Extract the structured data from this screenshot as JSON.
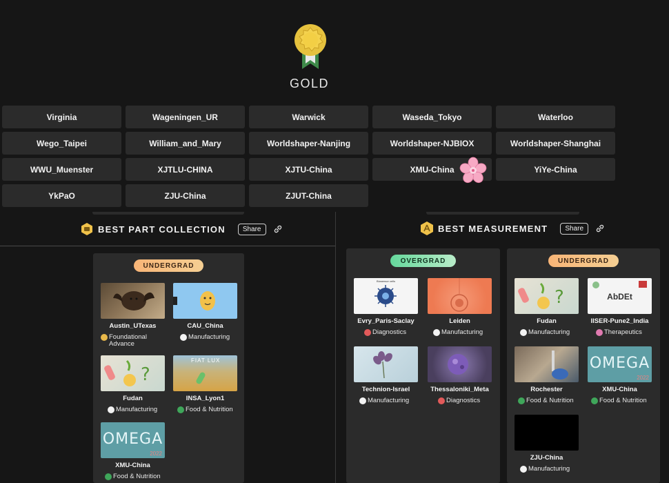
{
  "award": {
    "title": "GOLD",
    "icon": "gold-medal-icon"
  },
  "teams": [
    "Virginia",
    "Wageningen_UR",
    "Warwick",
    "Waseda_Tokyo",
    "Waterloo",
    "Wego_Taipei",
    "William_and_Mary",
    "Worldshaper-Nanjing",
    "Worldshaper-NJBIOX",
    "Worldshaper-Shanghai",
    "WWU_Muenster",
    "XJTLU-CHINA",
    "XJTU-China",
    "XMU-China",
    "YiYe-China",
    "YkPaO",
    "ZJU-China",
    "ZJUT-China"
  ],
  "sections": {
    "part_collection": {
      "title": "BEST PART COLLECTION",
      "share": "Share",
      "icon": "part-collection-icon",
      "undergrad_label": "UNDERGRAD",
      "cards": [
        {
          "name": "Austin_UTexas",
          "tag": "Foundational Advance",
          "tag_color": "#e8b84a",
          "thumb": "bat-photo"
        },
        {
          "name": "CAU_China",
          "tag": "Manufacturing",
          "tag_color": "#f2f2f2",
          "thumb": "cartoon-mascot"
        },
        {
          "name": "Fudan",
          "tag": "Manufacturing",
          "tag_color": "#f2f2f2",
          "thumb": "cartoon-collage"
        },
        {
          "name": "INSA_Lyon1",
          "tag": "Food & Nutrition",
          "tag_color": "#3fa65a",
          "thumb": "wheat-field"
        },
        {
          "name": "XMU-China",
          "tag": "Food & Nutrition",
          "tag_color": "#3fa65a",
          "thumb": "omega-logo"
        }
      ]
    },
    "measurement": {
      "title": "BEST MEASUREMENT",
      "share": "Share",
      "icon": "measurement-icon",
      "overgrad_label": "OVERGRAD",
      "undergrad_label": "UNDERGRAD",
      "overgrad_cards": [
        {
          "name": "Evry_Paris-Saclay",
          "tag": "Diagnostics",
          "tag_color": "#e25a5a",
          "thumb": "virus-diagram"
        },
        {
          "name": "Leiden",
          "tag": "Manufacturing",
          "tag_color": "#f2f2f2",
          "thumb": "orange-cells"
        },
        {
          "name": "Technion-Israel",
          "tag": "Manufacturing",
          "tag_color": "#f2f2f2",
          "thumb": "flower-sketch"
        },
        {
          "name": "Thessaloniki_Meta",
          "tag": "Diagnostics",
          "tag_color": "#e25a5a",
          "thumb": "purple-blob"
        }
      ],
      "undergrad_cards": [
        {
          "name": "Fudan",
          "tag": "Manufacturing",
          "tag_color": "#f2f2f2",
          "thumb": "cartoon-collage"
        },
        {
          "name": "IISER-Pune2_India",
          "tag": "Therapeutics",
          "tag_color": "#e07ab0",
          "thumb": "abdetect-logo"
        },
        {
          "name": "Rochester",
          "tag": "Food & Nutrition",
          "tag_color": "#3fa65a",
          "thumb": "lab-photo"
        },
        {
          "name": "XMU-China",
          "tag": "Food & Nutrition",
          "tag_color": "#3fa65a",
          "thumb": "omega-logo"
        },
        {
          "name": "ZJU-China",
          "tag": "Manufacturing",
          "tag_color": "#f2f2f2",
          "thumb": "black-image"
        }
      ]
    }
  },
  "thumb_text": {
    "omega": "OMEGA",
    "omega_year": "2022",
    "fiat": "FIAT LUX",
    "abdet": "AbDEt",
    "evry": "Biosensor cells"
  }
}
